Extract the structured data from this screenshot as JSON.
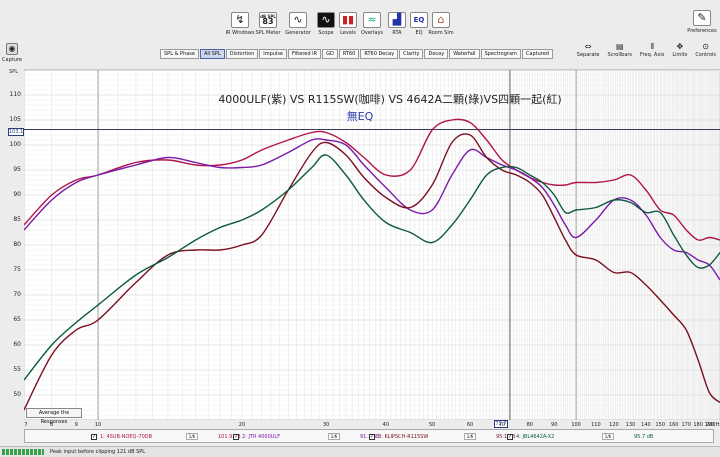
{
  "toolbar": {
    "items": [
      {
        "label": "IR Windows",
        "icon": "ir-windows-icon"
      },
      {
        "label": "SPL Meter",
        "icon": "spl-meter-icon",
        "value": "83"
      },
      {
        "label": "Generator",
        "icon": "generator-icon"
      },
      {
        "label": "Scope",
        "icon": "scope-icon"
      },
      {
        "label": "Levels",
        "icon": "levels-icon"
      },
      {
        "label": "Overlays",
        "icon": "overlays-icon"
      },
      {
        "label": "RTA",
        "icon": "rta-icon"
      },
      {
        "label": "EQ",
        "icon": "eq-icon"
      },
      {
        "label": "Room Sim",
        "icon": "room-sim-icon"
      }
    ],
    "spl_header": "dB SPL",
    "preferences": "Preferences"
  },
  "tabs": [
    "SPL & Phase",
    "All SPL",
    "Distortion",
    "Impulse",
    "Filtered IR",
    "GD",
    "RT60",
    "RT60 Decay",
    "Clarity",
    "Decay",
    "Waterfall",
    "Spectrogram",
    "Captured"
  ],
  "active_tab": "All SPL",
  "right_tools": [
    "Separate",
    "Scrollbars",
    "Freq. Axis",
    "Limits",
    "Controls"
  ],
  "capture_label": "Capture",
  "y_axis_label": "SPL",
  "chart_title": "4000ULF(紫) VS R115SW(咖啡) VS 4642A二顆(綠)VS四顆一起(紅)",
  "chart_subtitle": "無EQ",
  "avg_button": "Average the Responses",
  "cursor_y_label": "103.1",
  "cursor_x_label": "72.7",
  "status_text": "Peak input before clipping 121 dB SPL",
  "legend": [
    {
      "name": "1: 4SUB-NOEQ-70DB",
      "smoothing": "1/6",
      "value": "101.9 dB",
      "color": "#b0134a"
    },
    {
      "name": "2: JTR 4000ULF",
      "smoothing": "1/6",
      "value": "91.1 dB",
      "color": "#7a1aa8"
    },
    {
      "name": "3: KLIPSCH-R115SW",
      "smoothing": "1/6",
      "value": "95.1 dB",
      "color": "#7a0f1e"
    },
    {
      "name": "4: JBL4642A-X2",
      "smoothing": "1/6",
      "value": "95.7 dB",
      "color": "#0b5a3e"
    }
  ],
  "chart_data": {
    "type": "line",
    "xscale": "log",
    "xlim": [
      7,
      200
    ],
    "ylim": [
      45,
      115
    ],
    "x_ticks": [
      "7",
      "8",
      "9",
      "10",
      "20",
      "30",
      "40",
      "50",
      "60",
      "70",
      "80",
      "90",
      "100",
      "110",
      "120",
      "130",
      "140",
      "150",
      "160",
      "170",
      "180",
      "190",
      "200Hz"
    ],
    "y_ticks": [
      50,
      55,
      60,
      65,
      70,
      75,
      80,
      85,
      90,
      95,
      100,
      105,
      110
    ],
    "cursor": {
      "x": 72.7,
      "y": 103.1
    },
    "series": [
      {
        "name": "1: 4SUB-NOEQ-70DB",
        "color": "#b0134a",
        "x": [
          7,
          8,
          9,
          10,
          12,
          14,
          16,
          18,
          20,
          22,
          25,
          28,
          30,
          33,
          36,
          40,
          45,
          50,
          55,
          60,
          65,
          70,
          75,
          80,
          85,
          90,
          95,
          100,
          110,
          120,
          130,
          140,
          150,
          160,
          170,
          180,
          190,
          200
        ],
        "y": [
          84,
          90,
          93,
          94,
          96.5,
          97,
          96,
          96,
          97,
          99,
          101,
          102.5,
          102.5,
          100.5,
          97.5,
          94,
          95,
          103,
          105,
          104.5,
          101,
          97,
          95,
          93.5,
          92.5,
          92,
          92,
          92.5,
          92.5,
          93,
          94,
          91,
          87,
          86,
          83,
          81,
          81.5,
          81
        ]
      },
      {
        "name": "2: JTR 4000ULF",
        "color": "#7a1aa8",
        "x": [
          7,
          8,
          9,
          10,
          12,
          14,
          16,
          18,
          20,
          22,
          25,
          28,
          30,
          33,
          36,
          40,
          45,
          50,
          55,
          60,
          65,
          70,
          75,
          80,
          85,
          90,
          95,
          100,
          110,
          120,
          130,
          140,
          150,
          160,
          170,
          180,
          190,
          200
        ],
        "y": [
          83,
          89,
          92.5,
          94,
          96,
          97.5,
          96.5,
          95.5,
          95.5,
          96,
          98.5,
          101,
          101,
          100,
          96,
          91.5,
          87,
          87,
          94,
          99,
          97.5,
          96,
          95,
          93.5,
          91.5,
          88,
          84,
          81.5,
          85,
          89,
          89,
          86,
          81.5,
          79,
          78.5,
          77,
          76,
          73
        ]
      },
      {
        "name": "3: KLIPSCH-R115SW",
        "color": "#7a0f1e",
        "x": [
          7,
          8,
          9,
          10,
          12,
          14,
          16,
          18,
          20,
          22,
          25,
          28,
          30,
          33,
          36,
          40,
          45,
          50,
          55,
          60,
          65,
          70,
          75,
          80,
          85,
          90,
          95,
          100,
          110,
          120,
          130,
          140,
          150,
          160,
          170,
          180,
          190,
          200
        ],
        "y": [
          47,
          58,
          63,
          65,
          72.5,
          78,
          79,
          79,
          80,
          82,
          91,
          98.5,
          100.5,
          98,
          93.5,
          89.5,
          87.5,
          92,
          100.5,
          102,
          97.5,
          95,
          94,
          92.5,
          90,
          85.5,
          81,
          78,
          77,
          74.5,
          74.5,
          72,
          69,
          66,
          63,
          57,
          50.5,
          48.5
        ]
      },
      {
        "name": "4: JBL4642A-X2",
        "color": "#0b5a3e",
        "x": [
          7,
          8,
          9,
          10,
          12,
          14,
          16,
          18,
          20,
          22,
          25,
          28,
          30,
          33,
          36,
          40,
          45,
          50,
          55,
          60,
          65,
          70,
          75,
          80,
          85,
          90,
          95,
          100,
          110,
          120,
          130,
          140,
          150,
          160,
          170,
          180,
          190,
          200
        ],
        "y": [
          53,
          60,
          64.5,
          68,
          74,
          77.5,
          81,
          83.5,
          85,
          87,
          91,
          95.5,
          98,
          94,
          89,
          84.5,
          82.5,
          80.5,
          84,
          89,
          94,
          95.5,
          95.5,
          94,
          92.5,
          90,
          86.5,
          87,
          87.5,
          89,
          88.5,
          86.5,
          86.5,
          82,
          78,
          75.5,
          76,
          78.5
        ]
      }
    ]
  }
}
